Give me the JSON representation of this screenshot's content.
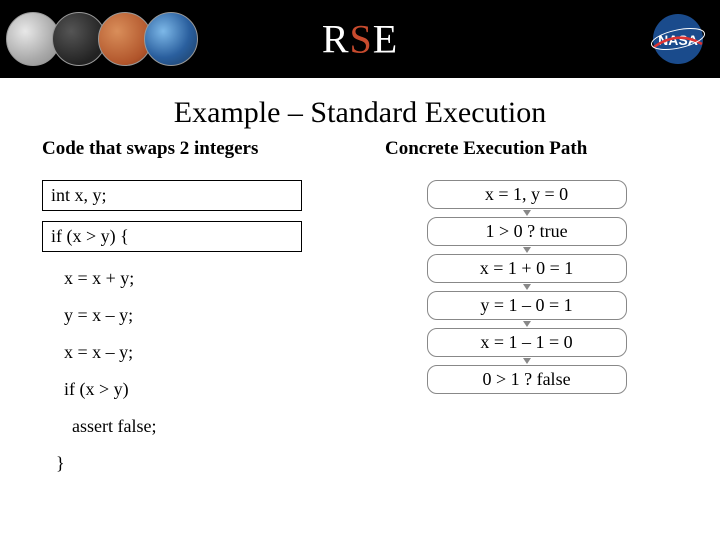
{
  "branding": {
    "prefix": "R",
    "accent": "S",
    "suffix": "E"
  },
  "title": "Example – Standard Execution",
  "left": {
    "heading": "Code that swaps 2 integers",
    "decl": "int x, y;",
    "cond": "if (x > y) {",
    "l1": "x = x + y;",
    "l2": "y = x – y;",
    "l3": "x = x – y;",
    "inner": "if (x > y)",
    "assert": "assert false;",
    "close": "}"
  },
  "right": {
    "heading": "Concrete Execution Path",
    "s1": "x = 1, y = 0",
    "s2": "1 > 0 ? true",
    "s3": "x = 1 + 0 = 1",
    "s4": "y = 1 – 0 = 1",
    "s5": "x = 1 – 1 = 0",
    "s6": "0 > 1 ? false"
  }
}
